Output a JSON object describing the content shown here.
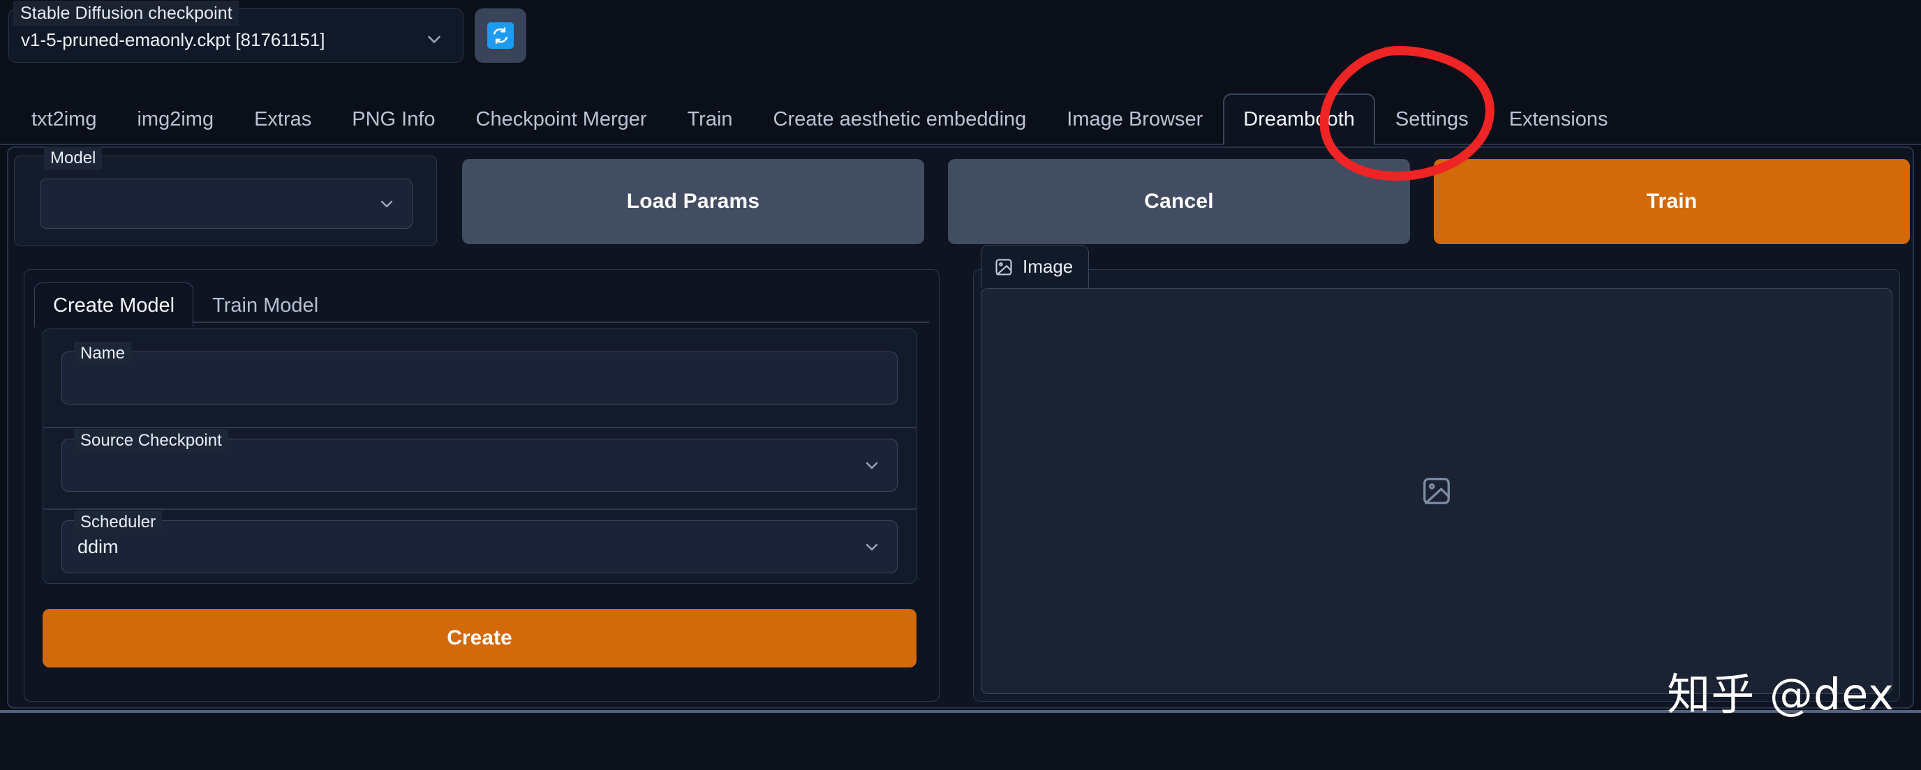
{
  "topbar": {
    "checkpoint_label": "Stable Diffusion checkpoint",
    "checkpoint_value": "v1-5-pruned-emaonly.ckpt [81761151]",
    "refresh_icon": "refresh-icon",
    "dropdown_icon": "chevron-down-icon"
  },
  "tabs": [
    {
      "label": "txt2img",
      "active": false
    },
    {
      "label": "img2img",
      "active": false
    },
    {
      "label": "Extras",
      "active": false
    },
    {
      "label": "PNG Info",
      "active": false
    },
    {
      "label": "Checkpoint Merger",
      "active": false
    },
    {
      "label": "Train",
      "active": false
    },
    {
      "label": "Create aesthetic embedding",
      "active": false
    },
    {
      "label": "Image Browser",
      "active": false
    },
    {
      "label": "Dreambooth",
      "active": true
    },
    {
      "label": "Settings",
      "active": false
    },
    {
      "label": "Extensions",
      "active": false
    }
  ],
  "annotation": {
    "shape": "hand-drawn-red-circle",
    "target": "Dreambooth",
    "color": "#ef2424"
  },
  "action_row": {
    "model_group_label": "Model",
    "model_value": "",
    "buttons": [
      {
        "label": "Load Params",
        "style": "gray"
      },
      {
        "label": "Cancel",
        "style": "gray"
      },
      {
        "label": "Train",
        "style": "orange"
      }
    ]
  },
  "left_panel": {
    "subtabs": [
      {
        "label": "Create Model",
        "active": true
      },
      {
        "label": "Train Model",
        "active": false
      }
    ],
    "fields": [
      {
        "label": "Name",
        "value": "",
        "type": "text"
      },
      {
        "label": "Source Checkpoint",
        "value": "",
        "type": "select"
      },
      {
        "label": "Scheduler",
        "value": "ddim",
        "type": "select"
      }
    ],
    "create_button": "Create"
  },
  "right_panel": {
    "image_tab_label": "Image",
    "image_tab_icon": "picture-icon",
    "placeholder_icon": "image-placeholder-icon"
  },
  "watermark": {
    "text": "知乎 @dex"
  },
  "colors": {
    "background": "#0b0f19",
    "panel": "#0e1422",
    "field": "#1b2436",
    "border": "#39455c",
    "accent_orange": "#d2690b",
    "button_gray": "#434d61",
    "refresh_blue": "#1d9bf0",
    "annotation_red": "#ef2424",
    "text_primary": "#eef2f8",
    "text_muted": "#b9c3d4"
  }
}
